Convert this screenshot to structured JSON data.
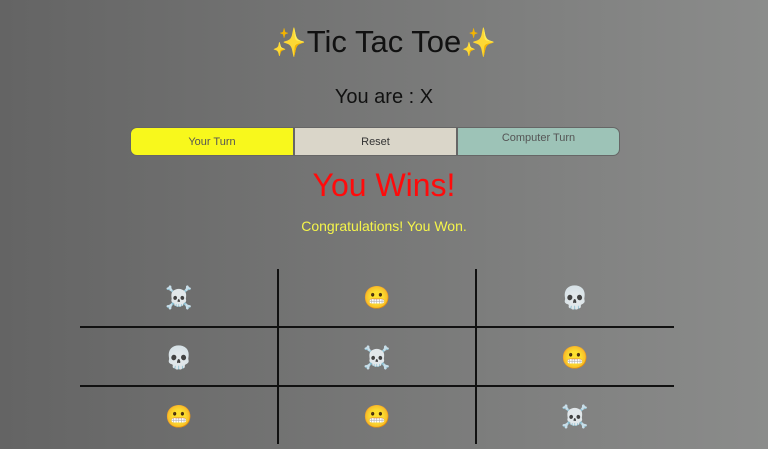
{
  "header": {
    "title": "Tic Tac Toe",
    "sparkle_glyph": "✨",
    "you_are": "You are : X"
  },
  "controls": {
    "your_turn_label": "Your Turn",
    "reset_label": "Reset",
    "computer_turn_label": "Computer Turn",
    "colors": {
      "your_turn": "#f8f81c",
      "reset": "#dad6c9",
      "computer_turn": "#9dc3b7"
    }
  },
  "status": {
    "result": "You Wins!",
    "message": "Congratulations! You Won.",
    "result_color": "#ff0b0b",
    "message_color": "#f5f54a"
  },
  "board": {
    "cells": [
      {
        "icon": "skull-and-crossbones-icon",
        "glyph": "☠️"
      },
      {
        "icon": "grimacing-face-icon",
        "glyph": "😬"
      },
      {
        "icon": "skull-icon",
        "glyph": "💀"
      },
      {
        "icon": "skull-icon",
        "glyph": "💀"
      },
      {
        "icon": "skull-and-crossbones-icon",
        "glyph": "☠️"
      },
      {
        "icon": "grimacing-face-icon",
        "glyph": "😬"
      },
      {
        "icon": "grimacing-face-icon",
        "glyph": "😬"
      },
      {
        "icon": "grimacing-face-icon",
        "glyph": "😬"
      },
      {
        "icon": "skull-and-crossbones-icon",
        "glyph": "☠️"
      }
    ]
  }
}
